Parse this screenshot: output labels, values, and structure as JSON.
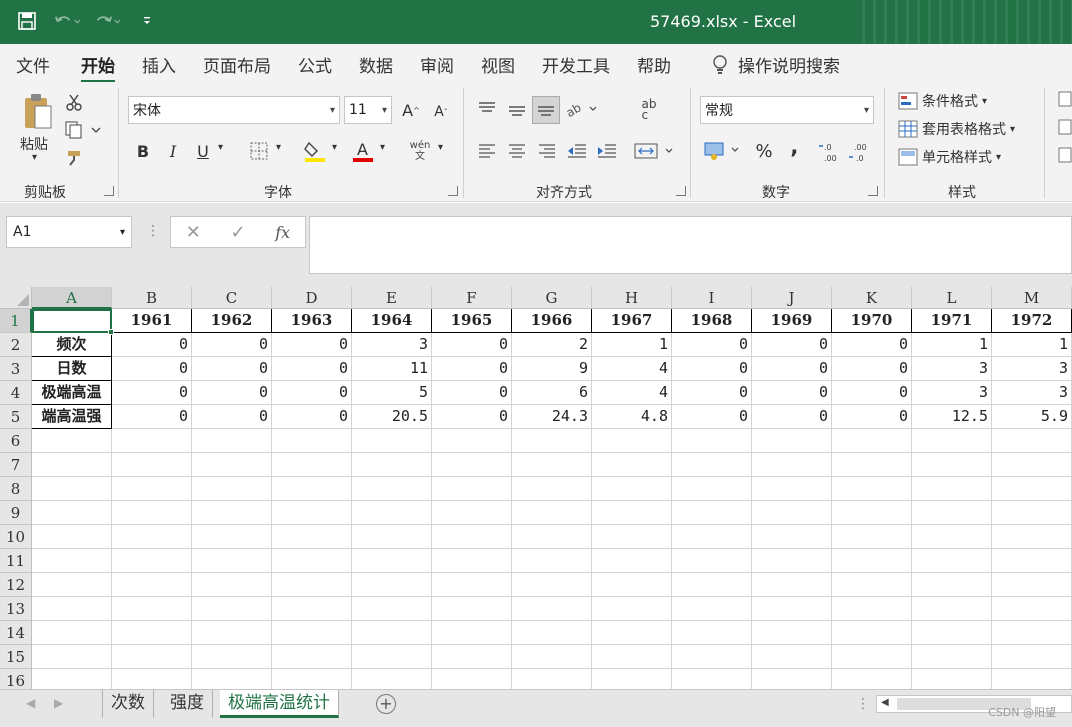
{
  "window": {
    "title": "57469.xlsx  -  Excel",
    "accent_color": "#217346"
  },
  "qat": {
    "save_icon": "save-icon",
    "undo_icon": "undo-icon",
    "redo_icon": "redo-icon",
    "customize_icon": "customize-qat-icon"
  },
  "menu": {
    "tabs": [
      "文件",
      "开始",
      "插入",
      "页面布局",
      "公式",
      "数据",
      "审阅",
      "视图",
      "开发工具",
      "帮助"
    ],
    "active": "开始",
    "tell_me": "操作说明搜索"
  },
  "ribbon": {
    "clipboard": {
      "paste_label": "粘贴",
      "group_label": "剪贴板"
    },
    "font": {
      "font_name": "宋体",
      "font_size": "11",
      "group_label": "字体",
      "bold": "B",
      "italic": "I",
      "underline": "U",
      "phonetic": "wén\n文"
    },
    "alignment": {
      "group_label": "对齐方式",
      "wrap": "ab\nc"
    },
    "number": {
      "format": "常规",
      "group_label": "数字",
      "percent": "%",
      "comma": "‚"
    },
    "styles": {
      "conditional_format": "条件格式",
      "format_as_table": "套用表格格式",
      "cell_styles": "单元格样式",
      "group_label": "样式"
    }
  },
  "formula_bar": {
    "name_box": "A1",
    "formula": "",
    "fx": "fx"
  },
  "sheet": {
    "columns": [
      "A",
      "B",
      "C",
      "D",
      "E",
      "F",
      "G",
      "H",
      "I",
      "J",
      "K",
      "L",
      "M"
    ],
    "rows": [
      "1",
      "2",
      "3",
      "4",
      "5",
      "6",
      "7",
      "8",
      "9",
      "10",
      "11",
      "12",
      "13",
      "14",
      "15",
      "16"
    ],
    "active_cell": "A1",
    "header_row": [
      "",
      "1961",
      "1962",
      "1963",
      "1964",
      "1965",
      "1966",
      "1967",
      "1968",
      "1969",
      "1970",
      "1971",
      "1972"
    ],
    "data_rows": [
      {
        "label": "频次",
        "values": [
          "0",
          "0",
          "0",
          "3",
          "0",
          "2",
          "1",
          "0",
          "0",
          "0",
          "1",
          "1"
        ]
      },
      {
        "label": "日数",
        "values": [
          "0",
          "0",
          "0",
          "11",
          "0",
          "9",
          "4",
          "0",
          "0",
          "0",
          "3",
          "3"
        ]
      },
      {
        "label": "极端高温",
        "values": [
          "0",
          "0",
          "0",
          "5",
          "0",
          "6",
          "4",
          "0",
          "0",
          "0",
          "3",
          "3"
        ]
      },
      {
        "label": "端高温强",
        "values": [
          "0",
          "0",
          "0",
          "20.5",
          "0",
          "24.3",
          "4.8",
          "0",
          "0",
          "0",
          "12.5",
          "5.9"
        ]
      }
    ]
  },
  "sheet_tabs": {
    "tabs": [
      "次数",
      "强度",
      "极端高温统计"
    ],
    "active": "极端高温统计"
  },
  "watermark": "CSDN @阳望"
}
